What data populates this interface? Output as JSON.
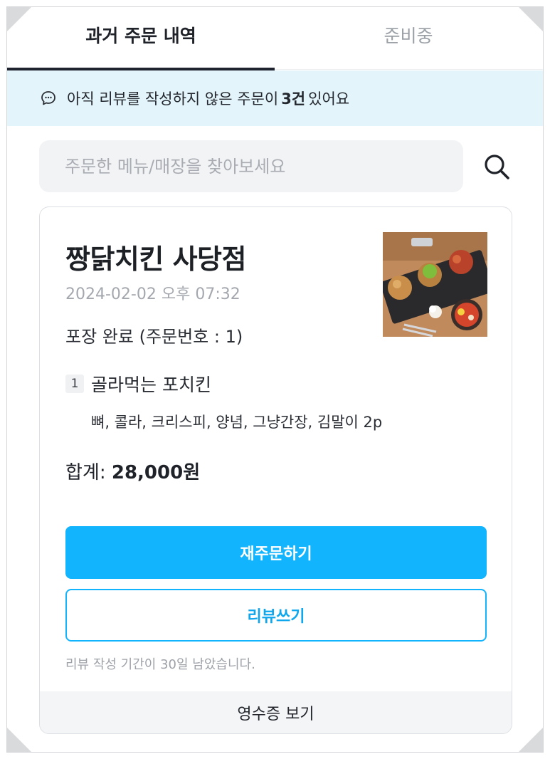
{
  "tabs": [
    {
      "label": "과거 주문 내역",
      "active": true
    },
    {
      "label": "준비중",
      "active": false
    }
  ],
  "notice": {
    "prefix": "아직 리뷰를 작성하지 않은 주문이",
    "count": "3건",
    "suffix": "있어요",
    "icon": "chat-bubble-icon"
  },
  "search": {
    "placeholder": "주문한 메뉴/매장을 찾아보세요",
    "value": "",
    "icon": "search-icon"
  },
  "order": {
    "store_name": "짱닭치킨 사당점",
    "date": "2024-02-02 오후 07:32",
    "status": "포장 완료 (주문번호 : 1)",
    "items": [
      {
        "quantity": "1",
        "name": "골라먹는 포치킨",
        "options": "뼈, 콜라, 크리스피, 양념, 그냥간장, 김말이 2p"
      }
    ],
    "total_label": "합계:",
    "total_value": "28,000원",
    "reorder_label": "재주문하기",
    "review_label": "리뷰쓰기",
    "review_period": "리뷰 작성 기간이 30일 남았습니다.",
    "receipt_label": "영수증 보기"
  },
  "colors": {
    "accent": "#12b4fd",
    "notice_bg": "#e3f4fb",
    "tab_indicator": "#1f2330"
  }
}
